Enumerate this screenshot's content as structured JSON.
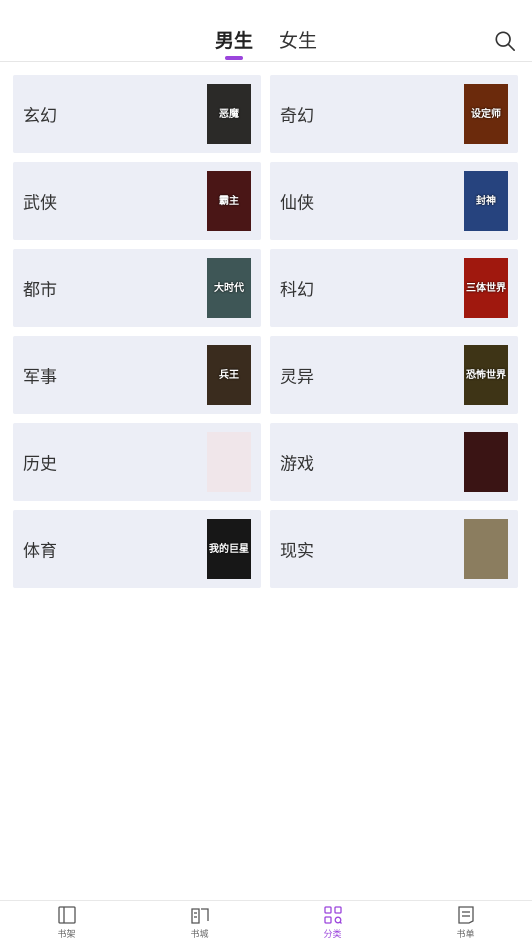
{
  "header": {
    "tabs": [
      {
        "label": "男生",
        "active": true
      },
      {
        "label": "女生",
        "active": false
      }
    ],
    "search_icon": "search-icon"
  },
  "categories": [
    {
      "name": "玄幻",
      "cover_text": "恶魔",
      "cover_bg": "#2b2a28"
    },
    {
      "name": "奇幻",
      "cover_text": "设定师",
      "cover_bg": "#6b2a0c"
    },
    {
      "name": "武侠",
      "cover_text": "霸主",
      "cover_bg": "#4a1616"
    },
    {
      "name": "仙侠",
      "cover_text": "封神",
      "cover_bg": "#26437e"
    },
    {
      "name": "都市",
      "cover_text": "大时代",
      "cover_bg": "#3e5656"
    },
    {
      "name": "科幻",
      "cover_text": "三体世界",
      "cover_bg": "#a0180e"
    },
    {
      "name": "军事",
      "cover_text": "兵王",
      "cover_bg": "#3a2c1e"
    },
    {
      "name": "灵异",
      "cover_text": "恐怖世界",
      "cover_bg": "#3e3416"
    },
    {
      "name": "历史",
      "cover_text": "",
      "cover_bg": "#f0e6ea"
    },
    {
      "name": "游戏",
      "cover_text": "",
      "cover_bg": "#3a1414"
    },
    {
      "name": "体育",
      "cover_text": "我的巨星",
      "cover_bg": "#171717"
    },
    {
      "name": "现实",
      "cover_text": "",
      "cover_bg": "#8b7d5f"
    }
  ],
  "bottom_nav": [
    {
      "label": "书架",
      "icon": "bookshelf-icon",
      "active": false
    },
    {
      "label": "书城",
      "icon": "bookstore-icon",
      "active": false
    },
    {
      "label": "分类",
      "icon": "category-icon",
      "active": true
    },
    {
      "label": "书单",
      "icon": "booklist-icon",
      "active": false
    }
  ],
  "colors": {
    "accent": "#9b45dc",
    "card_bg": "#eceef6"
  }
}
